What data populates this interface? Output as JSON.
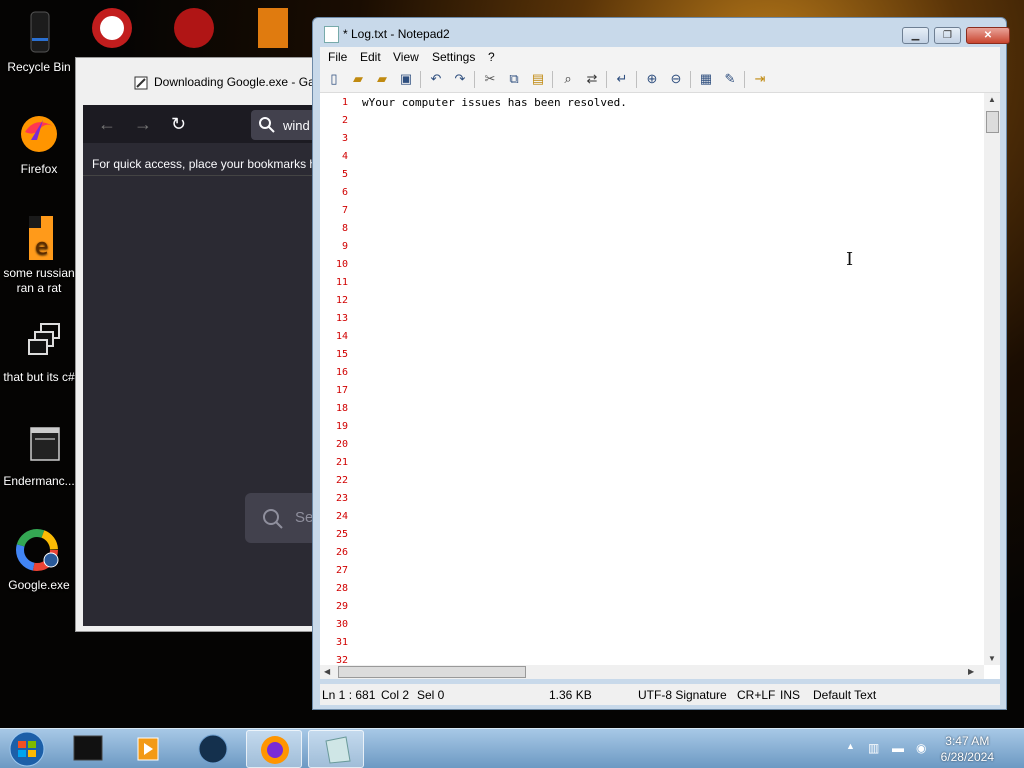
{
  "desktop": {
    "icons": [
      {
        "label": "Recycle Bin"
      },
      {
        "label": "Firefox"
      },
      {
        "label": "some russian ran a rat"
      },
      {
        "label": "that but its c#"
      },
      {
        "label": "Endermanc..."
      },
      {
        "label": "Google.exe"
      }
    ]
  },
  "browser": {
    "title": "Downloading Google.exe - Ga",
    "url_text": "wind",
    "bookmarks_hint": "For quick access, place your bookmarks h",
    "search_placeholder": "Se"
  },
  "notepad": {
    "title": "* Log.txt - Notepad2",
    "menu": [
      "File",
      "Edit",
      "View",
      "Settings",
      "?"
    ],
    "content": "wYour computer issues has been resolved.",
    "line_numbers": [
      "1",
      "2",
      "3",
      "4",
      "5",
      "6",
      "7",
      "8",
      "9",
      "10",
      "11",
      "12",
      "13",
      "14",
      "15",
      "16",
      "17",
      "18",
      "19",
      "20",
      "21",
      "22",
      "23",
      "24",
      "25",
      "26",
      "27",
      "28",
      "29",
      "30",
      "31",
      "32"
    ],
    "status": {
      "position": "Ln 1 : 681",
      "col": "Col 2",
      "sel": "Sel 0",
      "size": "1.36 KB",
      "encoding": "UTF-8 Signature",
      "eol": "CR+LF",
      "mode": "INS",
      "scheme": "Default Text"
    }
  },
  "taskbar": {
    "time": "3:47 AM",
    "date": "6/28/2024"
  }
}
